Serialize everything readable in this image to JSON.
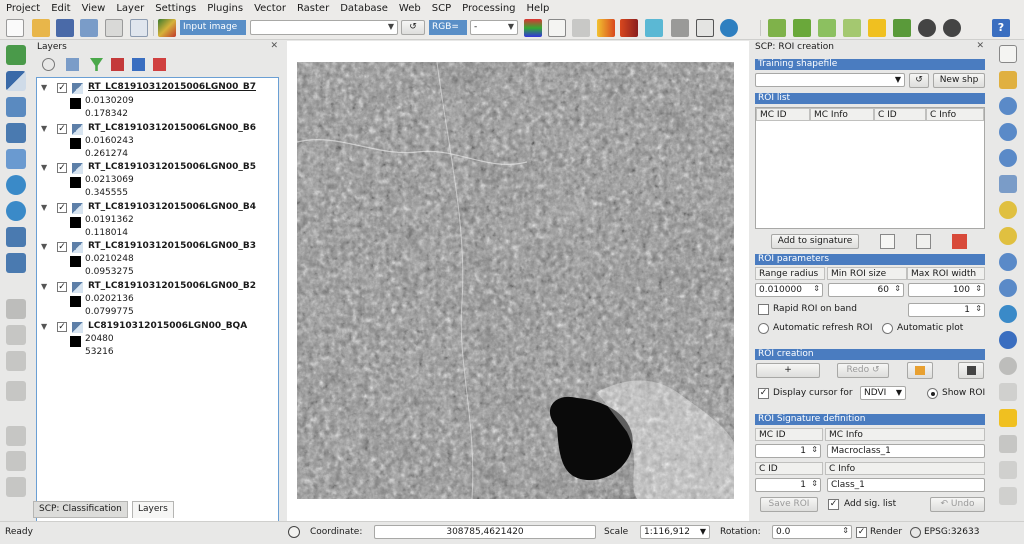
{
  "menu": [
    "Project",
    "Edit",
    "View",
    "Layer",
    "Settings",
    "Plugins",
    "Vector",
    "Raster",
    "Database",
    "Web",
    "SCP",
    "Processing",
    "Help"
  ],
  "toolbar": {
    "input_image_label": "Input image",
    "input_image_value": "",
    "refresh_label": "↺",
    "rgb_label": "RGB=",
    "rgb_value": "-"
  },
  "layers": {
    "title": "Layers",
    "items": [
      {
        "name": "RT_LC81910312015006LGN00_B7",
        "min": "0.0130209",
        "max": "0.178342"
      },
      {
        "name": "RT_LC81910312015006LGN00_B6",
        "min": "0.0160243",
        "max": "0.261274"
      },
      {
        "name": "RT_LC81910312015006LGN00_B5",
        "min": "0.0213069",
        "max": "0.345555"
      },
      {
        "name": "RT_LC81910312015006LGN00_B4",
        "min": "0.0191362",
        "max": "0.118014"
      },
      {
        "name": "RT_LC81910312015006LGN00_B3",
        "min": "0.0210248",
        "max": "0.0953275"
      },
      {
        "name": "RT_LC81910312015006LGN00_B2",
        "min": "0.0202136",
        "max": "0.0799775"
      },
      {
        "name": "LC81910312015006LGN00_BQA",
        "min": "20480",
        "max": "53216"
      }
    ],
    "tabs": [
      "SCP: Classification",
      "Layers"
    ]
  },
  "scp": {
    "title": "SCP: ROI creation",
    "training_header": "Training shapefile",
    "training_value": "",
    "new_shp": "New shp",
    "roi_list_header": "ROI list",
    "roi_cols": [
      "MC ID",
      "MC Info",
      "C ID",
      "C Info"
    ],
    "add_to_signature": "Add to signature",
    "roi_params_header": "ROI parameters",
    "param_cols": [
      "Range radius",
      "Min ROI size",
      "Max ROI width"
    ],
    "range_radius": "0.010000",
    "min_roi_size": "60",
    "max_roi_width": "100",
    "rapid_roi_label": "Rapid ROI on band",
    "rapid_roi_band": "1",
    "auto_refresh_label": "Automatic refresh ROI",
    "auto_plot_label": "Automatic  plot",
    "roi_creation_header": "ROI creation",
    "plus_label": "+",
    "redo_label": "Redo ↺",
    "display_cursor_label": "Display cursor for",
    "display_cursor_value": "NDVI",
    "show_roi_label": "Show ROI",
    "sig_def_header": "ROI Signature definition",
    "mc_id_label": "MC ID",
    "mc_info_label": "MC Info",
    "mc_id_value": "1",
    "mc_info_value": "Macroclass_1",
    "c_id_label": "C ID",
    "c_info_label": "C Info",
    "c_id_value": "1",
    "c_info_value": "Class_1",
    "save_roi": "Save ROI",
    "add_sig_list": "Add sig. list",
    "undo_label": "↶ Undo"
  },
  "status": {
    "ready": "Ready",
    "coordinate_label": "Coordinate:",
    "coordinate_value": "308785,4621420",
    "scale_label": "Scale",
    "scale_value": "1:116,912",
    "rotation_label": "Rotation:",
    "rotation_value": "0.0",
    "render_label": "Render",
    "crs": "EPSG:32633"
  },
  "colors": {
    "accent": "#4a7cc0",
    "selection": "#5a8fc7",
    "lake": "#0a0a0a"
  }
}
